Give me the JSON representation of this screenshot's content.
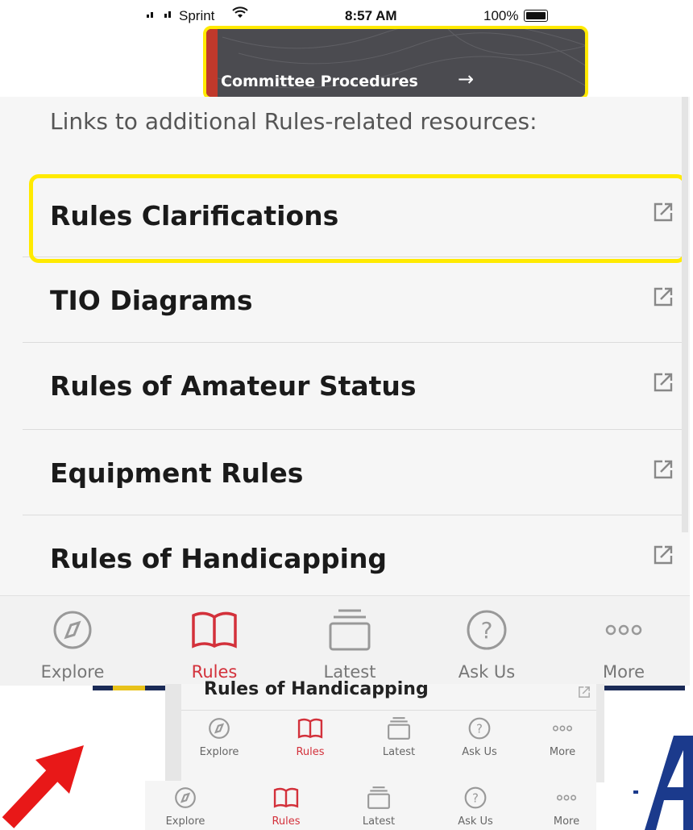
{
  "status_bar": {
    "carrier": "Sprint",
    "time": "8:57 AM",
    "battery": "100%"
  },
  "committee_card": {
    "label": "Committee Procedures",
    "arrow": "→"
  },
  "panel": {
    "intro": "Links to additional Rules-related resources:",
    "rows": [
      {
        "label": "Rules Clarifications",
        "icon": "external-link-icon"
      },
      {
        "label": "TIO Diagrams",
        "icon": "external-link-icon"
      },
      {
        "label": "Rules of Amateur Status",
        "icon": "external-link-icon"
      },
      {
        "label": "Equipment Rules",
        "icon": "external-link-icon"
      },
      {
        "label": "Rules of Handicapping",
        "icon": "external-link-icon"
      }
    ]
  },
  "tabs": [
    {
      "label": "Explore",
      "icon": "compass-icon",
      "active": false
    },
    {
      "label": "Rules",
      "icon": "book-icon",
      "active": true
    },
    {
      "label": "Latest",
      "icon": "stack-icon",
      "active": false
    },
    {
      "label": "Ask Us",
      "icon": "question-icon",
      "active": false
    },
    {
      "label": "More",
      "icon": "more-dots-icon",
      "active": false
    }
  ],
  "mini_screens": {
    "partial_title": "Rules of Handicapping",
    "tabs_a": [
      "Explore",
      "Rules",
      "Latest",
      "Ask Us",
      "More"
    ],
    "tabs_b": [
      "Explore",
      "Rules",
      "Latest",
      "Ask Us",
      "More"
    ]
  },
  "colors": {
    "accent_red": "#d3313b",
    "highlight_yellow": "#ffea00",
    "card_stripe": "#c0392b",
    "logo_blue": "#1b3a8c"
  }
}
